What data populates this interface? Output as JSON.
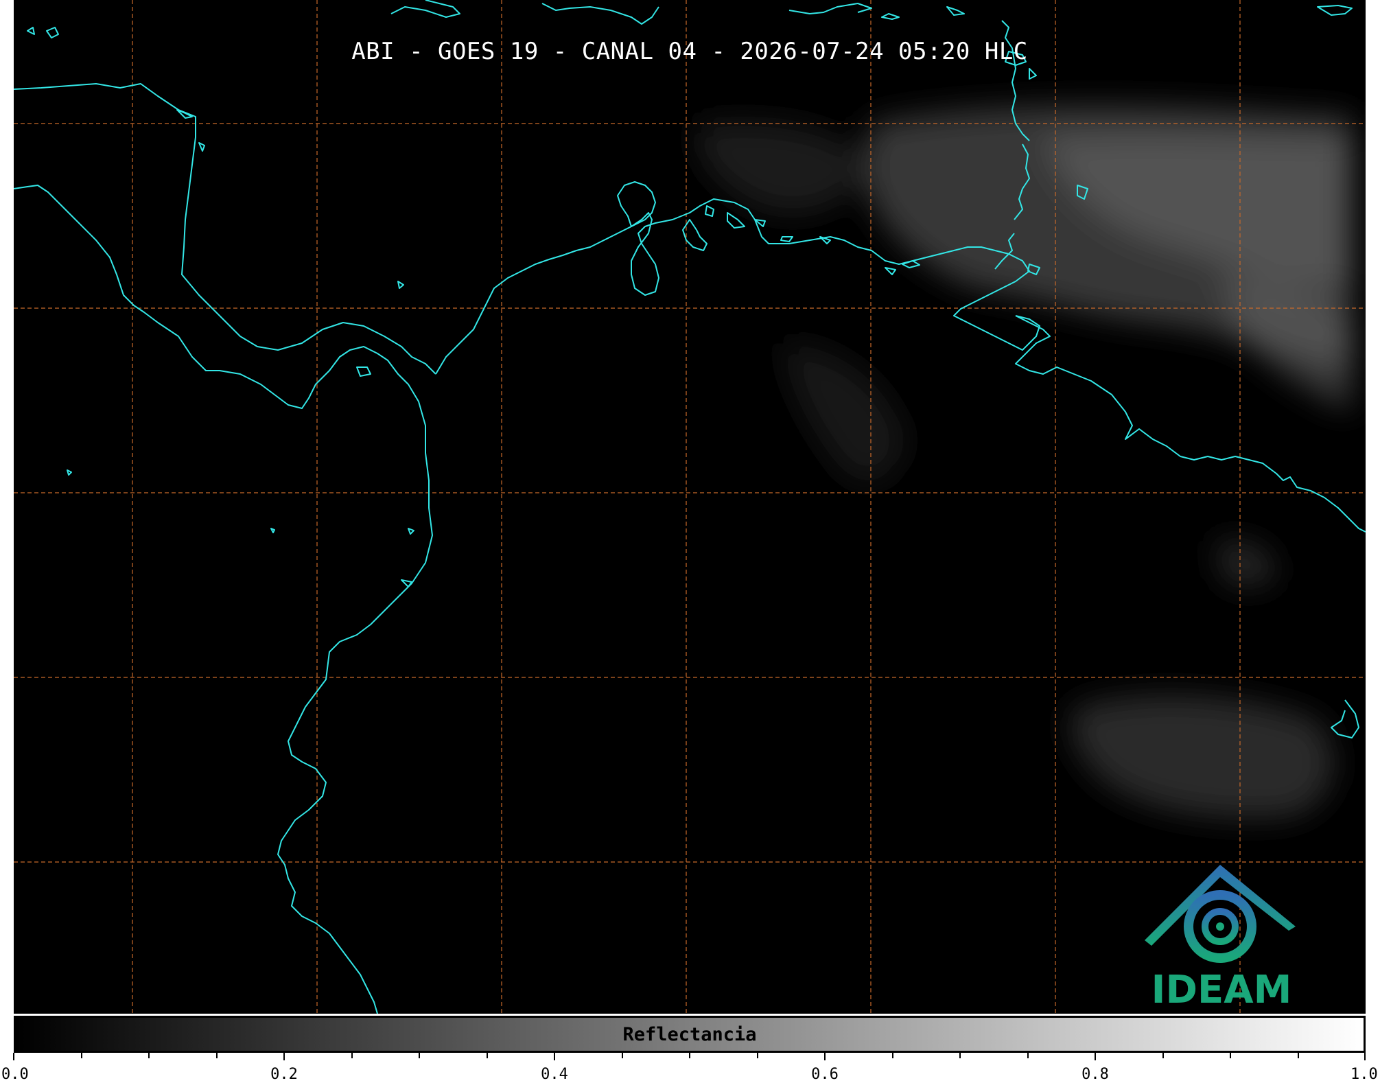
{
  "title": "ABI - GOES 19 - CANAL 04 - 2026-07-24 05:20 HLC",
  "logo": {
    "text": "IDEAM",
    "color": "#1aa87a"
  },
  "colorbar": {
    "label": "Reflectancia",
    "range": [
      0.0,
      1.0
    ],
    "tick_labels": [
      "0.0",
      "0.2",
      "0.4",
      "0.6",
      "0.8",
      "1.0"
    ],
    "major_ticks": [
      0.0,
      0.2,
      0.4,
      0.6,
      0.8,
      1.0
    ],
    "minor_ticks": [
      0.05,
      0.1,
      0.15,
      0.25,
      0.3,
      0.35,
      0.45,
      0.5,
      0.55,
      0.65,
      0.7,
      0.75,
      0.85,
      0.9,
      0.95
    ],
    "start_color": "#000000",
    "end_color": "#ffffff"
  },
  "map_style": {
    "background": "#000000",
    "coastline_color": "#33e6e6",
    "gridline_color": "#c8692a",
    "gridline_style": "dashed"
  }
}
